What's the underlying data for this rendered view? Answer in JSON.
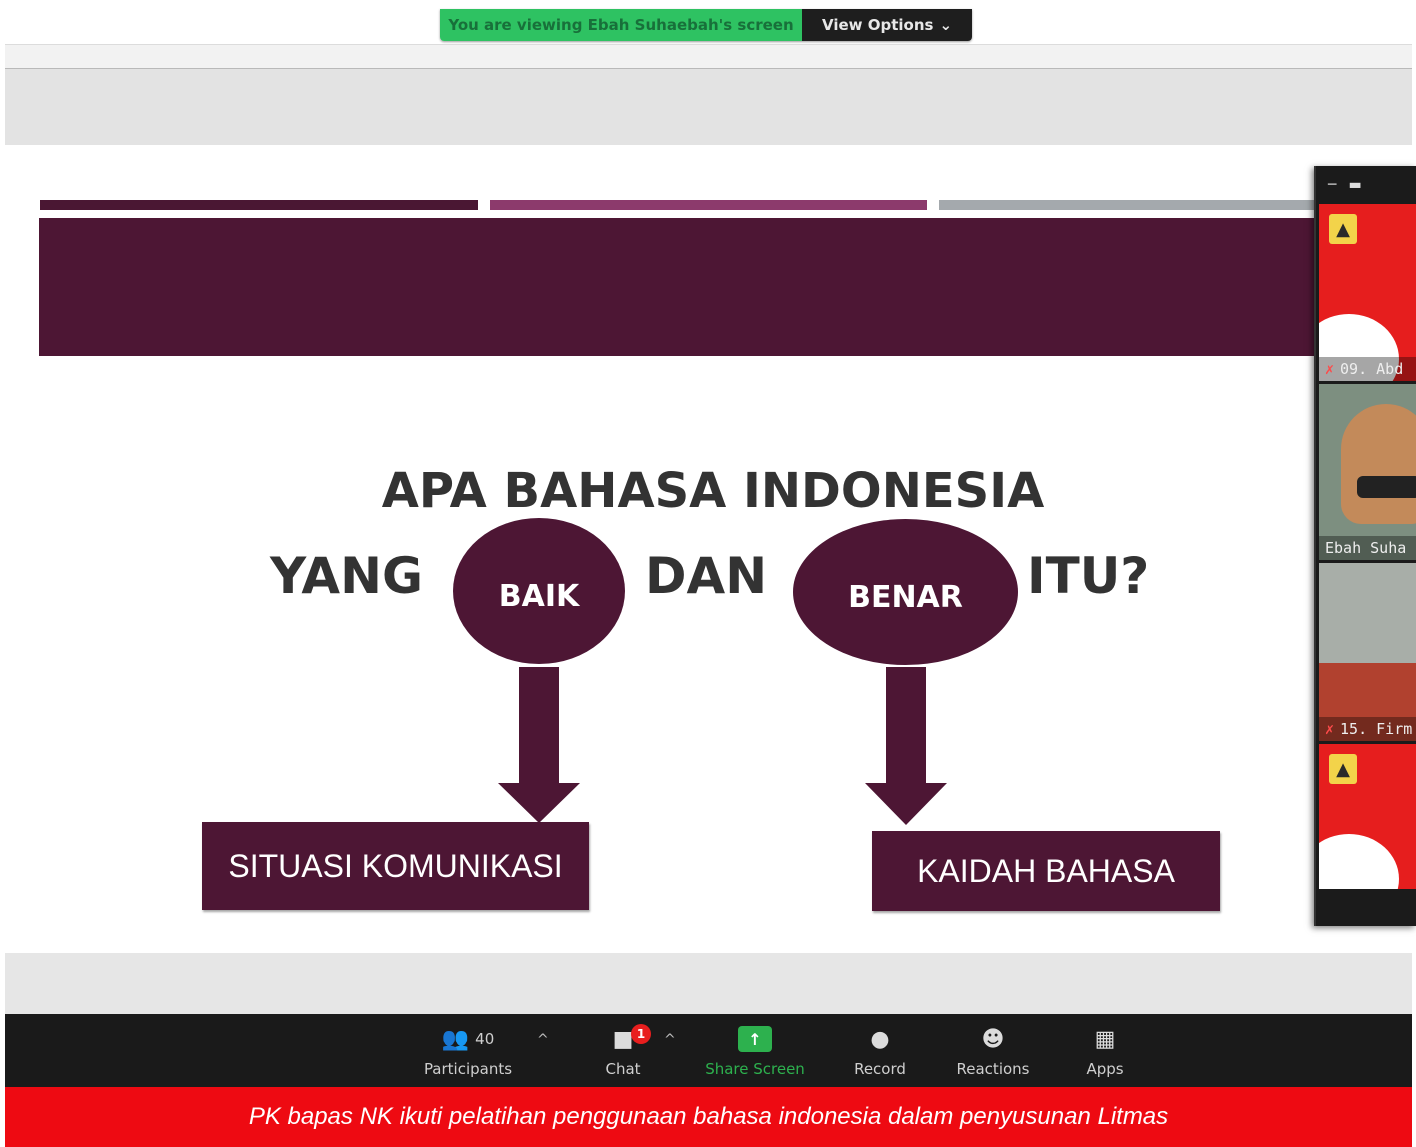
{
  "banner": {
    "viewing_text": "You are viewing Ebah Suhaebah's screen",
    "view_options_label": "View Options",
    "view_options_caret": "⌄"
  },
  "slide": {
    "question_line1": "APA BAHASA INDONESIA",
    "word_yang": "YANG",
    "oval_left": "BAIK",
    "word_dan": "DAN",
    "oval_right": "BENAR",
    "word_itu": "ITU?",
    "box_left": "SITUASI KOMUNIKASI",
    "box_right": "KAIDAH BAHASA",
    "colors": {
      "maroon": "#4d1634",
      "mauve": "#8c3a6c",
      "gray": "#a4a9ad"
    }
  },
  "participants_panel": {
    "controls": [
      "minimize-icon",
      "window-icon"
    ],
    "tiles": [
      {
        "name": "09. Abd",
        "muted": true,
        "type": "logo"
      },
      {
        "name": "Ebah Suha",
        "muted": false,
        "type": "video"
      },
      {
        "name": "15. Firm",
        "muted": true,
        "type": "video"
      },
      {
        "name": "",
        "muted": false,
        "type": "logo"
      }
    ]
  },
  "toolbar": {
    "participants_label": "Participants",
    "participants_count": "40",
    "chat_label": "Chat",
    "chat_badge": "1",
    "share_label": "Share Screen",
    "record_label": "Record",
    "reactions_label": "Reactions",
    "apps_label": "Apps",
    "caret": "^",
    "icons": {
      "participants": "people-icon",
      "chat": "chat-bubble-icon",
      "share": "share-arrow-icon",
      "record": "record-icon",
      "reactions": "smiley-icon",
      "apps": "apps-icon"
    }
  },
  "caption": {
    "text": "PK bapas NK ikuti pelatihan penggunaan bahasa indonesia dalam penyusunan Litmas"
  }
}
